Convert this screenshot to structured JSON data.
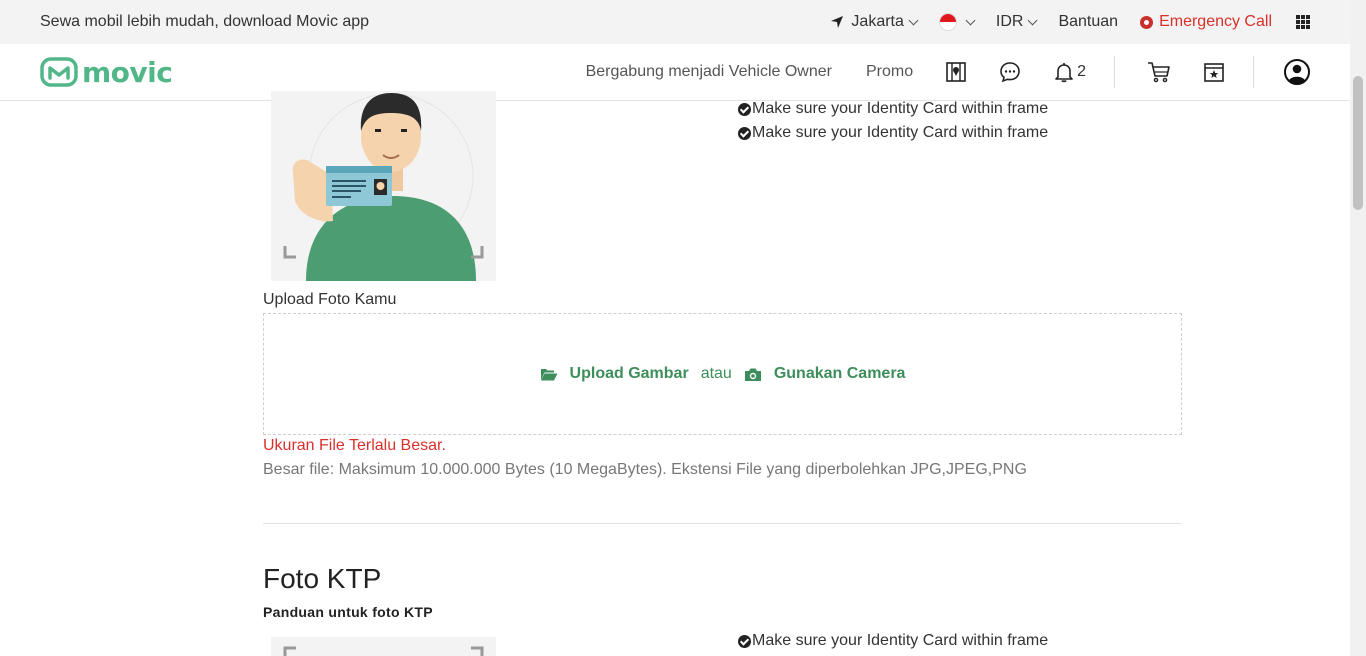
{
  "topbar": {
    "tagline": "Sewa mobil lebih mudah, download Movic app",
    "city": "Jakarta",
    "currency": "IDR",
    "help": "Bantuan",
    "emergency": "Emergency Call"
  },
  "nav": {
    "logo": "movic",
    "vehicle_owner": "Bergabung menjadi Vehicle Owner",
    "promo": "Promo",
    "notif_count": "2"
  },
  "guide": {
    "check_1": "Make sure your Identity Card within frame",
    "check_2": "Make sure your Identity Card within frame",
    "check_3": "Make sure your Identity Card within frame"
  },
  "upload": {
    "label": "Upload Foto Kamu",
    "upload_image": "Upload Gambar",
    "or": "atau",
    "use_camera": "Gunakan Camera",
    "error": "Ukuran File Terlalu Besar.",
    "hint": "Besar file: Maksimum 10.000.000 Bytes (10 MegaBytes). Ekstensi File yang diperbolehkan JPG,JPEG,PNG"
  },
  "ktp": {
    "title": "Foto KTP",
    "subtitle": "Panduan untuk foto KTP"
  },
  "colors": {
    "brand": "#52b788",
    "action": "#3e8e5c",
    "error": "#d9302c"
  }
}
